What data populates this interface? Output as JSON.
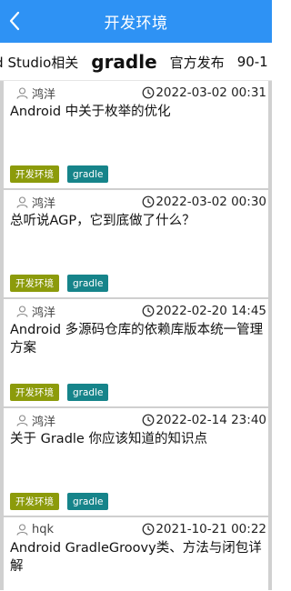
{
  "appbar": {
    "title": "开发环境",
    "back_icon": "chevron-left-icon"
  },
  "tabs": [
    {
      "label": "roid Studio相关",
      "active": false
    },
    {
      "label": "gradle",
      "active": true
    },
    {
      "label": "官方发布",
      "active": false
    },
    {
      "label": "90-1",
      "active": false
    }
  ],
  "colors": {
    "appbar": "#2e92f4",
    "tag_env": "#8c9b0b",
    "tag_gradle": "#16848a"
  },
  "articles": [
    {
      "author": "鸿洋",
      "time": "2022-03-02 00:31",
      "title": "Android 中关于枚举的优化",
      "tags": [
        "开发环境",
        "gradle"
      ]
    },
    {
      "author": "鸿洋",
      "time": "2022-03-02 00:30",
      "title": "总听说AGP，它到底做了什么？",
      "tags": [
        "开发环境",
        "gradle"
      ]
    },
    {
      "author": "鸿洋",
      "time": "2022-02-20 14:45",
      "title": "Android 多源码仓库的依赖库版本统一管理方案",
      "tags": [
        "开发环境",
        "gradle"
      ]
    },
    {
      "author": "鸿洋",
      "time": "2022-02-14 23:40",
      "title": "关于 Gradle 你应该知道的知识点",
      "tags": [
        "开发环境",
        "gradle"
      ]
    },
    {
      "author": "hqk",
      "time": "2021-10-21 00:22",
      "title": "Android GradleGroovy类、方法与闭包详解",
      "tags": []
    }
  ]
}
